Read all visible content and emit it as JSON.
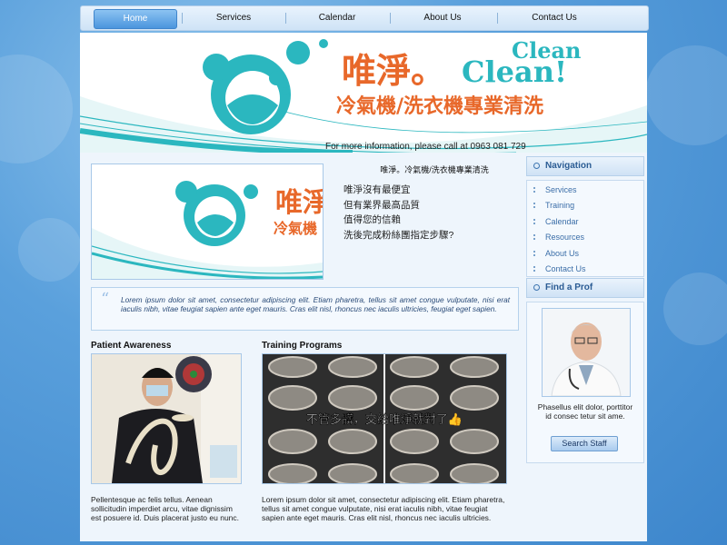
{
  "nav": {
    "items": [
      "Home",
      "Services",
      "Calendar",
      "About Us",
      "Contact Us"
    ]
  },
  "banner": {
    "brand_cn": "唯淨。",
    "brand_en_1": "Clean",
    "brand_en_2": "Clean!",
    "tagline": "冷氣機/洗衣機專業清洗",
    "phone_line": "For more information, please call at 0963 081 729"
  },
  "hero": {
    "brand_cn": "唯淨",
    "tagline": "冷氣機"
  },
  "intro": {
    "title": "唯淨。冷氣機/洗衣機專業清洗",
    "lines": [
      "唯淨沒有最便宜",
      "但有業界最高品質",
      "值得您的信賴",
      "洗後完成粉絲團指定步驟?"
    ]
  },
  "quote": {
    "text": "Lorem ipsum dolor sit amet, consectetur adipiscing elit. Etiam pharetra, tellus sit amet congue vulputate, nisi erat iaculis nibh, vitae feugiat sapien ante eget mauris. Cras elit nisl, rhoncus nec iaculis ultricies, feugiat eget sapien."
  },
  "patient": {
    "title": "Patient Awareness",
    "text": "Pellentesque ac felis tellus. Aenean sollicitudin imperdiet arcu, vitae dignissim est posuere id. Duis placerat justo eu nunc."
  },
  "training": {
    "title": "Training Programs",
    "overlay": "不管多髒，交給唯淨就對了👍",
    "text": "Lorem ipsum dolor sit amet, consectetur adipiscing elit. Etiam pharetra, tellus sit amet congue vulputate, nisi erat iaculis nibh, vitae feugiat sapien ante eget mauris. Cras elit nisl, rhoncus nec iaculis ultricies."
  },
  "sidebar": {
    "nav_title": "Navigation",
    "links": [
      "Services",
      "Training",
      "Calendar",
      "Resources",
      "About Us",
      "Contact Us"
    ],
    "prof_title": "Find a Prof",
    "prof_text": "Phasellus elit dolor, porttitor id consec tetur sit ame.",
    "search_label": "Search Staff"
  },
  "colors": {
    "teal": "#2bb7bf",
    "orange": "#e8682a",
    "accent_blue": "#4b95dd"
  }
}
